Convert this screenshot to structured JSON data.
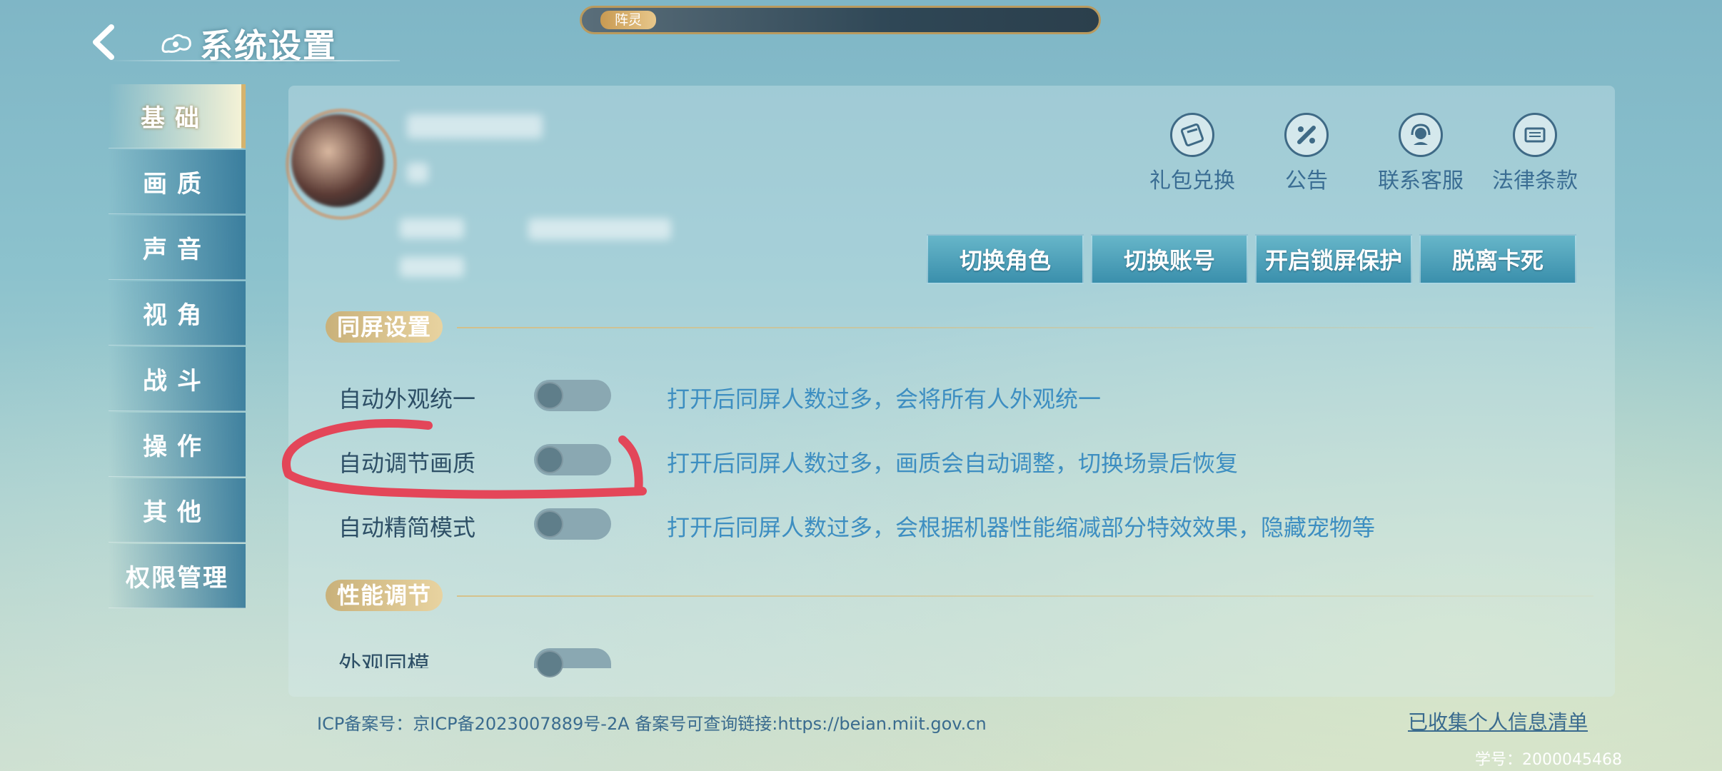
{
  "topbar": {
    "label": "阵灵"
  },
  "header": {
    "title": "系统设置"
  },
  "sidebar": {
    "items": [
      {
        "label": "基础",
        "active": true
      },
      {
        "label": "画质",
        "active": false
      },
      {
        "label": "声音",
        "active": false
      },
      {
        "label": "视角",
        "active": false
      },
      {
        "label": "战斗",
        "active": false
      },
      {
        "label": "操作",
        "active": false
      },
      {
        "label": "其他",
        "active": false
      },
      {
        "label": "权限管理",
        "active": false
      }
    ]
  },
  "quick_links": [
    {
      "label": "礼包兑换",
      "icon": "gift-code-icon"
    },
    {
      "label": "公告",
      "icon": "announcement-icon"
    },
    {
      "label": "联系客服",
      "icon": "customer-service-icon"
    },
    {
      "label": "法律条款",
      "icon": "legal-terms-icon"
    }
  ],
  "actions": {
    "switch_role": "切换角色",
    "switch_account": "切换账号",
    "lock_screen": "开启锁屏保护",
    "unstuck": "脱离卡死"
  },
  "sections": {
    "same_screen": {
      "title": "同屏设置",
      "settings": [
        {
          "label": "自动外观统一",
          "description": "打开后同屏人数过多，会将所有人外观统一",
          "enabled": false
        },
        {
          "label": "自动调节画质",
          "description": "打开后同屏人数过多，画质会自动调整，切换场景后恢复",
          "enabled": false
        },
        {
          "label": "自动精简模式",
          "description": "打开后同屏人数过多，会根据机器性能缩减部分特效效果，隐藏宠物等",
          "enabled": false
        }
      ]
    },
    "performance": {
      "title": "性能调节",
      "settings": [
        {
          "label": "外观同模",
          "enabled": false
        }
      ]
    }
  },
  "footer": {
    "icp": "ICP备案号：京ICP备2023007889号-2A  备案号可查询链接:https://beian.miit.gov.cn",
    "privacy_link": "已收集个人信息清单",
    "student_id": "学号：2000045468"
  },
  "colors": {
    "accent": "#3d8ec1",
    "label": "#2d4f66",
    "button": "#3a8fac",
    "section_gold": "#c9b17a",
    "annotation_red": "#e8354a"
  }
}
